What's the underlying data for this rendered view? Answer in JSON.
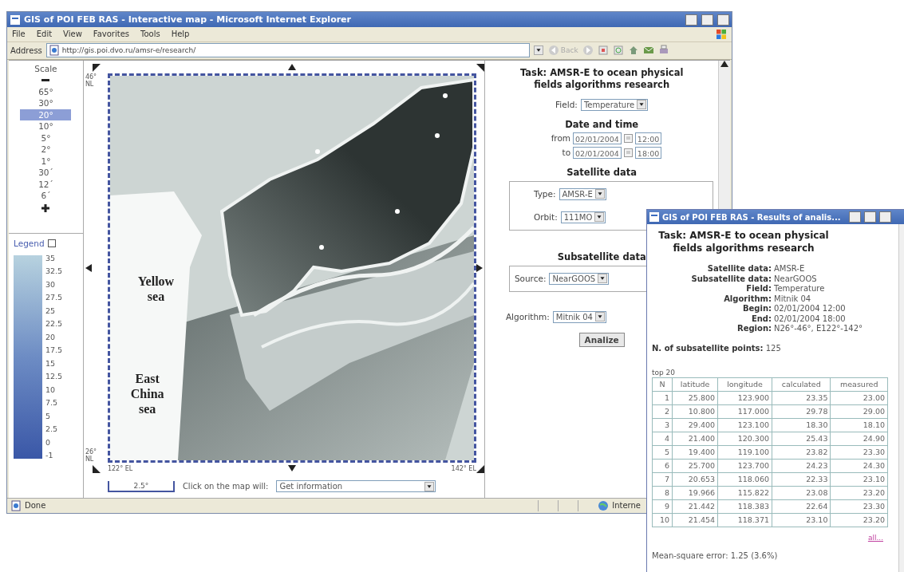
{
  "main_window": {
    "title": "GIS of POI FEB RAS - Interactive map - Microsoft Internet Explorer",
    "menu": [
      "File",
      "Edit",
      "View",
      "Favorites",
      "Tools",
      "Help"
    ],
    "address_label": "Address",
    "address": "http://gis.poi.dvo.ru/amsr-e/research/",
    "back_label": "Back",
    "scale": {
      "title": "Scale",
      "items": [
        {
          "label": "65°",
          "selected": false
        },
        {
          "label": "30°",
          "selected": false
        },
        {
          "label": "20°",
          "selected": true
        },
        {
          "label": "10°",
          "selected": false
        },
        {
          "label": "5°",
          "selected": false
        },
        {
          "label": "2°",
          "selected": false
        },
        {
          "label": "1°",
          "selected": false
        },
        {
          "label": "30´",
          "selected": false
        },
        {
          "label": "12´",
          "selected": false
        },
        {
          "label": "6´",
          "selected": false
        }
      ]
    },
    "legend": {
      "title": "Legend",
      "checked": false,
      "values": [
        "35",
        "32.5",
        "30",
        "27.5",
        "25",
        "22.5",
        "20",
        "17.5",
        "15",
        "12.5",
        "10",
        "7.5",
        "5",
        "2.5",
        "0",
        "-1"
      ]
    },
    "map": {
      "labels": [
        "Yellow sea",
        "East China sea"
      ],
      "lat_top": "46° NL",
      "lat_bottom": "26° NL",
      "lon_left": "122° EL",
      "lon_right": "142° EL",
      "scale_bar": "2.5°",
      "click_label": "Click on the map will:",
      "click_action": "Get information"
    },
    "form": {
      "task": "Task: AMSR-E to ocean physical fields algorithms research",
      "field_label": "Field:",
      "field": "Temperature",
      "date_title": "Date and time",
      "dates": [
        {
          "label": "from",
          "date": "02/01/2004",
          "time": "12:00"
        },
        {
          "label": "to",
          "date": "02/01/2004",
          "time": "18:00"
        }
      ],
      "satellite_title": "Satellite data",
      "type_label": "Type:",
      "type": "AMSR-E",
      "orbit_label": "Orbit:",
      "orbit": "111MO",
      "subsatellite_title": "Subsatellite data",
      "source_label": "Source:",
      "source": "NearGOOS",
      "algorithm_label": "Algorithm:",
      "algorithm": "Mitnik 04",
      "button": "Analize"
    },
    "status": {
      "text": "Done",
      "zone": "Interne"
    }
  },
  "results_window": {
    "title": "GIS of POI FEB RAS - Results of analis...",
    "task": "Task: AMSR-E to ocean physical fields algorithms research",
    "details": [
      {
        "label": "Satellite data:",
        "value": "AMSR-E"
      },
      {
        "label": "Subsatellite data:",
        "value": "NearGOOS"
      },
      {
        "label": "Field:",
        "value": "Temperature"
      },
      {
        "label": "Algorithm:",
        "value": "Mitnik 04"
      },
      {
        "label": "Begin:",
        "value": "02/01/2004 12:00"
      },
      {
        "label": "End:",
        "value": "02/01/2004 18:00"
      },
      {
        "label": "Region:",
        "value": "N26°-46°, E122°-142°"
      }
    ],
    "points_label": "N. of subsatellite points:",
    "points": "125",
    "top_label": "top 20",
    "columns": [
      "N",
      "latitude",
      "longitude",
      "calculated",
      "measured"
    ],
    "rows": [
      [
        "1",
        "25.800",
        "123.900",
        "23.35",
        "23.00"
      ],
      [
        "2",
        "10.800",
        "117.000",
        "29.78",
        "29.00"
      ],
      [
        "3",
        "29.400",
        "123.100",
        "18.30",
        "18.10"
      ],
      [
        "4",
        "21.400",
        "120.300",
        "25.43",
        "24.90"
      ],
      [
        "5",
        "19.400",
        "119.100",
        "23.82",
        "23.30"
      ],
      [
        "6",
        "25.700",
        "123.700",
        "24.23",
        "24.30"
      ],
      [
        "7",
        "20.653",
        "118.060",
        "22.33",
        "23.10"
      ],
      [
        "8",
        "19.966",
        "115.822",
        "23.08",
        "23.20"
      ],
      [
        "9",
        "21.442",
        "118.383",
        "22.64",
        "23.30"
      ],
      [
        "10",
        "21.454",
        "118.371",
        "23.10",
        "23.20"
      ]
    ],
    "all_link": "all...",
    "error": "Mean-square error: 1.25 (3.6%)"
  }
}
